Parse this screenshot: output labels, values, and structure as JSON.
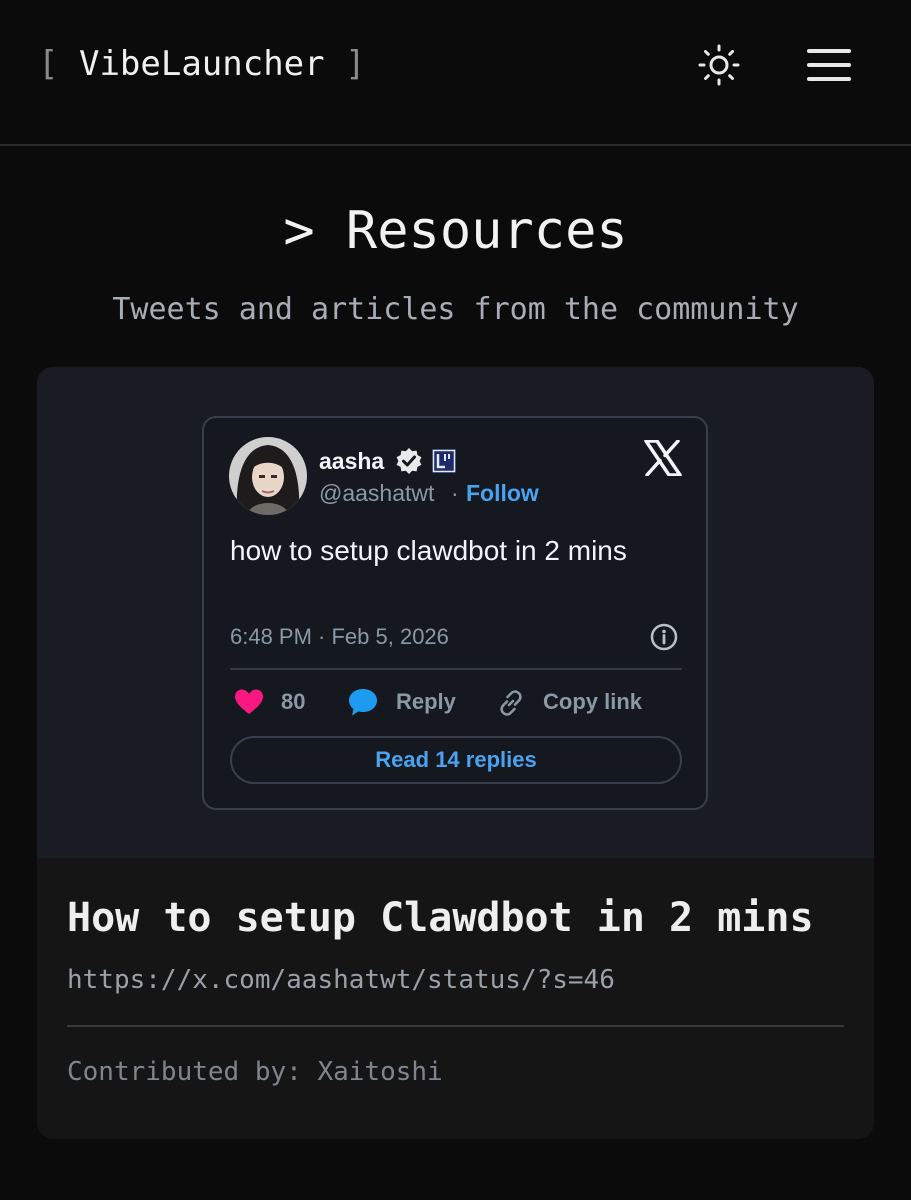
{
  "header": {
    "bracket_open": "[",
    "app_name": "VibeLauncher",
    "bracket_close": "]",
    "theme_icon": "sun-icon",
    "menu_icon": "hamburger-menu-icon"
  },
  "page": {
    "title": "> Resources",
    "subtitle": "Tweets and articles from the community"
  },
  "resource": {
    "tweet": {
      "author_name": "aasha",
      "author_handle": "@aashatwt",
      "separator": "·",
      "follow_label": "Follow",
      "text": "how to setup clawdbot in 2 mins",
      "timestamp": "6:48 PM · Feb 5, 2026",
      "like_count": "80",
      "reply_label": "Reply",
      "copy_link_label": "Copy link",
      "read_replies_label": "Read 14 replies",
      "icons": [
        "verified-badge-icon",
        "affiliate-badge-icon",
        "x-logo-icon",
        "info-icon",
        "heart-icon",
        "reply-bubble-icon",
        "link-icon"
      ]
    },
    "title": "How to setup Clawdbot in 2 mins",
    "url": "https://x.com/aashatwt/status/?s=46",
    "contributed_by": "Contributed by: Xaitoshi"
  },
  "colors": {
    "background": "#0b0b0b",
    "card": "#151515",
    "tweet_bg": "#15181f",
    "link_blue": "#4aa3f0",
    "like_pink": "#f91880",
    "verified_blue": "#e7e9ea"
  }
}
